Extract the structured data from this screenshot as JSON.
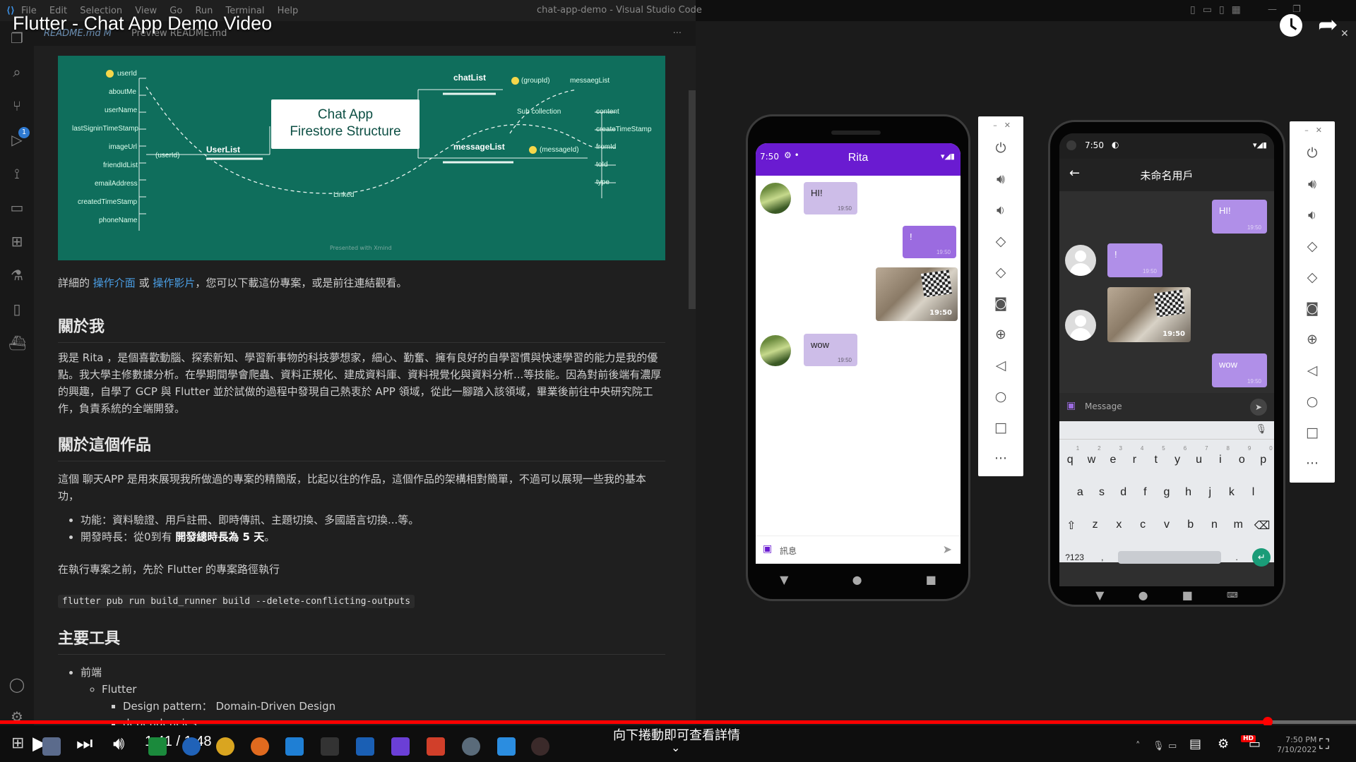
{
  "vscode": {
    "menu": [
      "File",
      "Edit",
      "Selection",
      "View",
      "Go",
      "Run",
      "Terminal",
      "Help"
    ],
    "window_title": "chat-app-demo - Visual Studio Code",
    "scm_badge": "1",
    "tabs": [
      "README.md M",
      "Preview README.md"
    ]
  },
  "video": {
    "title": "Flutter - Chat App Demo Video",
    "time": "1:41 / 1:48",
    "progress": 0.935,
    "scroll_hint": "向下捲動即可查看詳情"
  },
  "diagram": {
    "title_line1": "Chat App",
    "title_line2": "Firestore Structure",
    "user_fields": [
      "userId",
      "aboutMe",
      "userName",
      "lastSigninTimeStamp",
      "imageUrl",
      "friendIdList",
      "emailAddress",
      "createdTimeStamp",
      "phoneName"
    ],
    "user_list": "UserList",
    "user_id_link": "(userId)",
    "linked": "Linked",
    "chat_list": "chatList",
    "group_id": "(groupId)",
    "message_list_key": "messaegList",
    "sub_collection": "Sub collection",
    "message_list": "messageList",
    "message_id": "(messageId)",
    "message_fields": [
      "content",
      "createTimeStamp",
      "fromId",
      "toId",
      "type"
    ],
    "footer": "Presented with Xmind"
  },
  "readme": {
    "intro_prefix": "詳細的",
    "link_ui": "操作介面",
    "or": "或",
    "link_video": "操作影片",
    "intro_suffix": "，您可以下載這份專案，或是前往連結觀看。",
    "h_about_me": "關於我",
    "about_me": "我是 Rita ，是個喜歡動腦、探索新知、學習新事物的科技夢想家，細心、勤奮、擁有良好的自學習慣與快速學習的能力是我的優點。我大學主修數據分析。在學期間學會爬蟲、資料正規化、建成資料庫、資料視覺化與資料分析...等技能。因為對前後端有濃厚的興趣，自學了 GCP 與 Flutter 並於試做的過程中發現自己熱衷於 APP 領域，從此一腳踏入該領域，畢業後前往中央研究院工作，負責系統的全端開發。",
    "h_about_work": "關於這個作品",
    "about_work": "這個 聊天APP 是用來展現我所做過的專案的精簡版，比起以往的作品，這個作品的架構相對簡單，不過可以展現一些我的基本功，",
    "bullet_features": "功能：資料驗證、用戶註冊、即時傳訊、主題切換、多國語言切換...等。",
    "bullet_duration_prefix": "開發時長：從0到有",
    "bullet_duration_bold": "開發總時長為 5 天",
    "bullet_duration_suffix": "。",
    "before_run": "在執行專案之前，先於 Flutter 的專案路徑執行",
    "command": "flutter pub run build_runner build --delete-conflicting-outputs",
    "h_tools": "主要工具",
    "tool_frontend": "前端",
    "tool_flutter": "Flutter",
    "tool_pattern": "Design pattern： Domain-Driven Design",
    "tool_dependencies": "dependencies"
  },
  "phone_left": {
    "status_time": "7:50",
    "title": "Rita",
    "messages": [
      {
        "text": "HI!",
        "time": "19:50",
        "side": "left"
      },
      {
        "text": "!",
        "time": "19:50",
        "side": "right"
      },
      {
        "text": "",
        "time": "19:50",
        "side": "right",
        "image": true
      },
      {
        "text": "wow",
        "time": "19:50",
        "side": "left"
      }
    ],
    "input_placeholder": "訊息"
  },
  "phone_right": {
    "status_time": "7:50",
    "title": "未命名用戶",
    "messages": [
      {
        "text": "HI!",
        "time": "19:50",
        "side": "right"
      },
      {
        "text": "!",
        "time": "19:50",
        "side": "left"
      },
      {
        "text": "",
        "time": "19:50",
        "side": "left",
        "image": true
      },
      {
        "text": "wow",
        "time": "19:50",
        "side": "right"
      }
    ],
    "input_placeholder": "Message",
    "keyboard": {
      "row1": [
        "q",
        "w",
        "e",
        "r",
        "t",
        "y",
        "u",
        "i",
        "o",
        "p"
      ],
      "row1_nums": [
        "1",
        "2",
        "3",
        "4",
        "5",
        "6",
        "7",
        "8",
        "9",
        "0"
      ],
      "row2": [
        "a",
        "s",
        "d",
        "f",
        "g",
        "h",
        "j",
        "k",
        "l"
      ],
      "row3": [
        "z",
        "x",
        "c",
        "v",
        "b",
        "n",
        "m"
      ],
      "symbols": "?123",
      "comma": ",",
      "period": "."
    }
  },
  "taskbar": {
    "clock_time": "7:50 PM",
    "clock_date": "7/10/2022"
  },
  "colors": {
    "accent_purple": "#6a1bd1",
    "bubble_left": "#cdbde8",
    "bubble_right": "#9b6be0",
    "diagram_bg": "#0f6e5c",
    "progress": "#ff0000"
  }
}
